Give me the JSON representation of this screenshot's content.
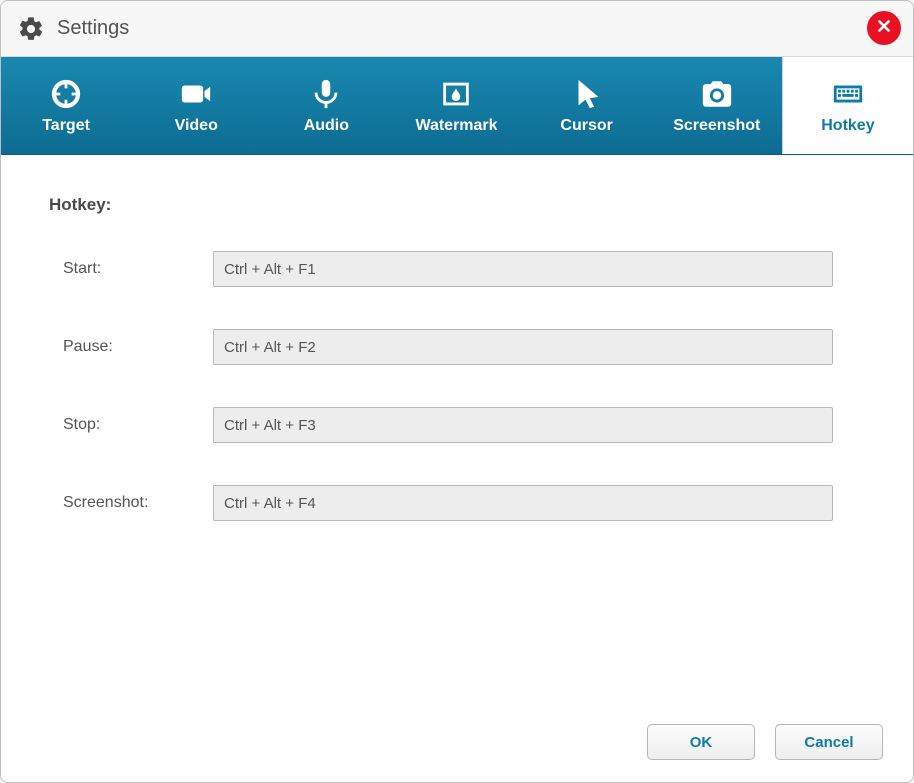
{
  "window": {
    "title": "Settings"
  },
  "tabs": [
    {
      "label": "Target"
    },
    {
      "label": "Video"
    },
    {
      "label": "Audio"
    },
    {
      "label": "Watermark"
    },
    {
      "label": "Cursor"
    },
    {
      "label": "Screenshot"
    },
    {
      "label": "Hotkey"
    }
  ],
  "content": {
    "section_title": "Hotkey:",
    "rows": [
      {
        "label": "Start:",
        "value": "Ctrl + Alt + F1"
      },
      {
        "label": "Pause:",
        "value": "Ctrl + Alt + F2"
      },
      {
        "label": "Stop:",
        "value": "Ctrl + Alt + F3"
      },
      {
        "label": "Screenshot:",
        "value": "Ctrl + Alt + F4"
      }
    ]
  },
  "buttons": {
    "ok": "OK",
    "cancel": "Cancel"
  }
}
